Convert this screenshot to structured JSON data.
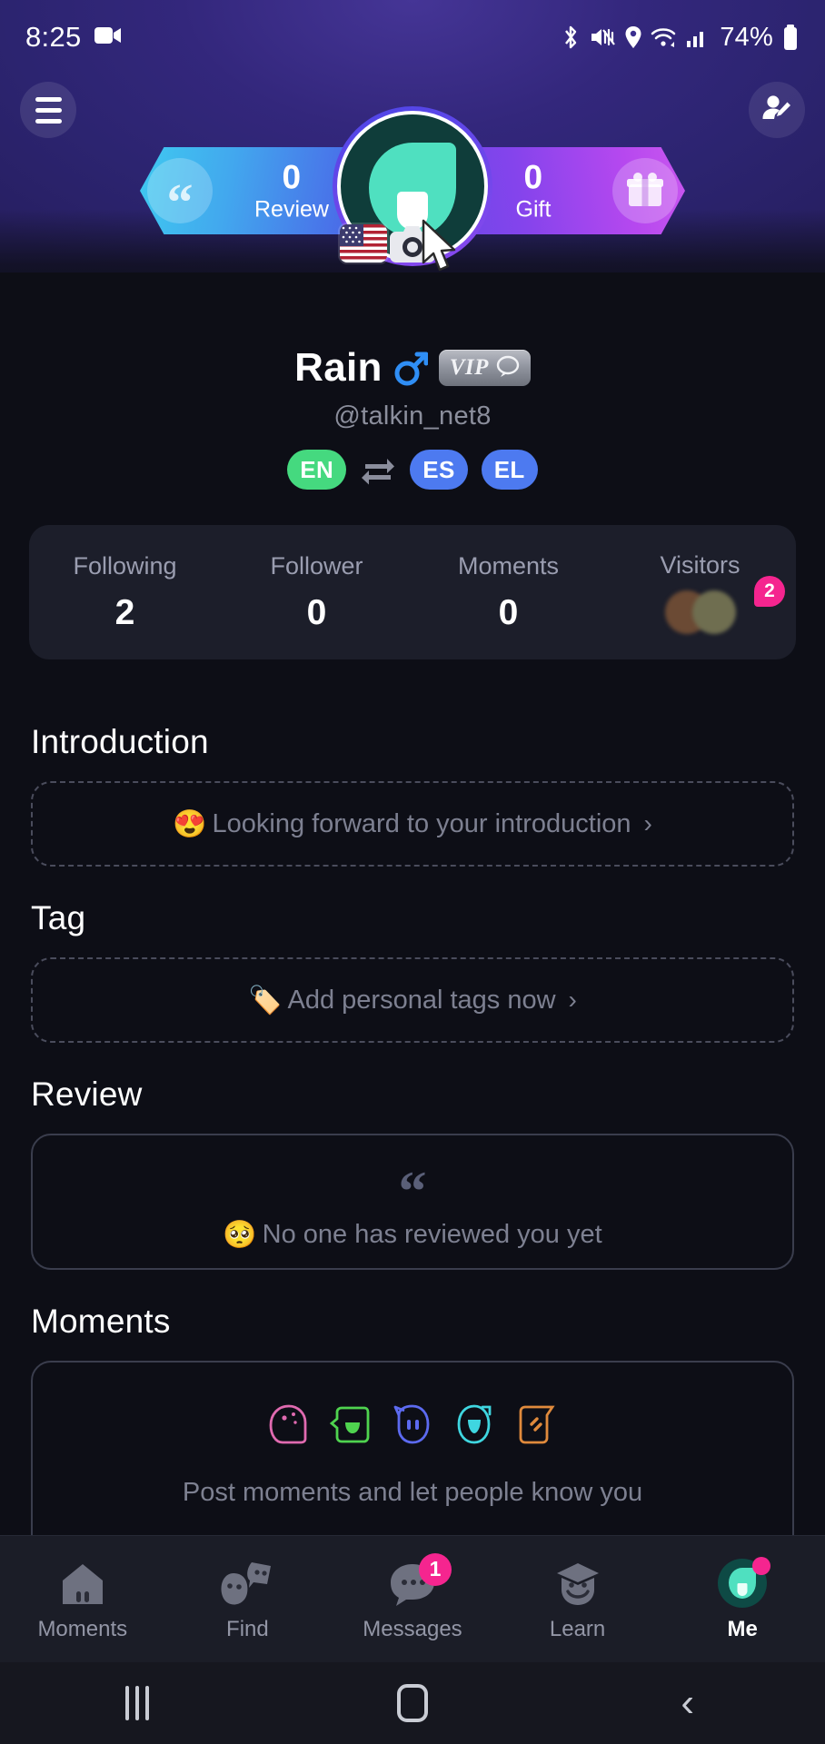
{
  "status_bar": {
    "time": "8:25",
    "battery_percent": "74%",
    "icons": [
      "screen-recorder-icon",
      "bluetooth-icon",
      "mute-vibrate-icon",
      "location-icon",
      "wifi-icon",
      "cellular-signal-icon",
      "battery-icon"
    ]
  },
  "header": {
    "menu_icon": "hamburger-menu-icon",
    "edit_profile_icon": "edit-profile-icon"
  },
  "banner": {
    "review": {
      "count": "0",
      "label": "Review",
      "icon": "quote-icon",
      "glyph": "“"
    },
    "gift": {
      "count": "0",
      "label": "Gift",
      "icon": "gift-icon"
    }
  },
  "avatar": {
    "flag": "us-flag-badge",
    "camera_icon": "camera-icon",
    "cursor": "mouse-cursor"
  },
  "profile": {
    "name": "Rain",
    "gender": "male",
    "vip_label": "VIP",
    "handle": "@talkin_net8",
    "languages": [
      {
        "code": "EN",
        "style": "native"
      },
      {
        "code": "ES",
        "style": "learning"
      },
      {
        "code": "EL",
        "style": "learning"
      }
    ],
    "swap_icon": "swap-arrows-icon"
  },
  "stats": [
    {
      "label": "Following",
      "value": "2"
    },
    {
      "label": "Follower",
      "value": "0"
    },
    {
      "label": "Moments",
      "value": "0"
    },
    {
      "label": "Visitors",
      "value": "",
      "badge": "2"
    }
  ],
  "sections": {
    "introduction": {
      "title": "Introduction",
      "emoji": "😍",
      "placeholder": "Looking forward to your introduction",
      "chevron": "›"
    },
    "tag": {
      "title": "Tag",
      "emoji": "🏷️",
      "placeholder": "Add personal tags now",
      "chevron": "›"
    },
    "review": {
      "title": "Review",
      "quote_glyph": "“",
      "emoji": "🥺",
      "placeholder": "No one has reviewed you yet"
    },
    "moments": {
      "title": "Moments",
      "placeholder": "Post moments and let people know you",
      "icon_colors": [
        "#e06ab0",
        "#4fd34f",
        "#5c6af0",
        "#3fd6e0",
        "#e08a3c"
      ]
    }
  },
  "tabbar": {
    "items": [
      {
        "label": "Moments",
        "icon": "house-icon",
        "active": false
      },
      {
        "label": "Find",
        "icon": "faces-icon",
        "active": false
      },
      {
        "label": "Messages",
        "icon": "chat-bubble-icon",
        "active": false,
        "badge": "1"
      },
      {
        "label": "Learn",
        "icon": "graduation-face-icon",
        "active": false
      },
      {
        "label": "Me",
        "icon": "profile-avatar-icon",
        "active": true,
        "dot": true
      }
    ]
  },
  "android_nav": {
    "recents": "recents-icon",
    "home": "home-icon",
    "back": "‹"
  },
  "colors": {
    "accent_pink": "#f5258f",
    "accent_teal": "#4fe0c0",
    "gradient_blue": "#42a8ee",
    "gradient_purple": "#b648ef",
    "lang_native": "#45d97f",
    "lang_learning": "#4d7af0",
    "background": "#0d0e16"
  }
}
